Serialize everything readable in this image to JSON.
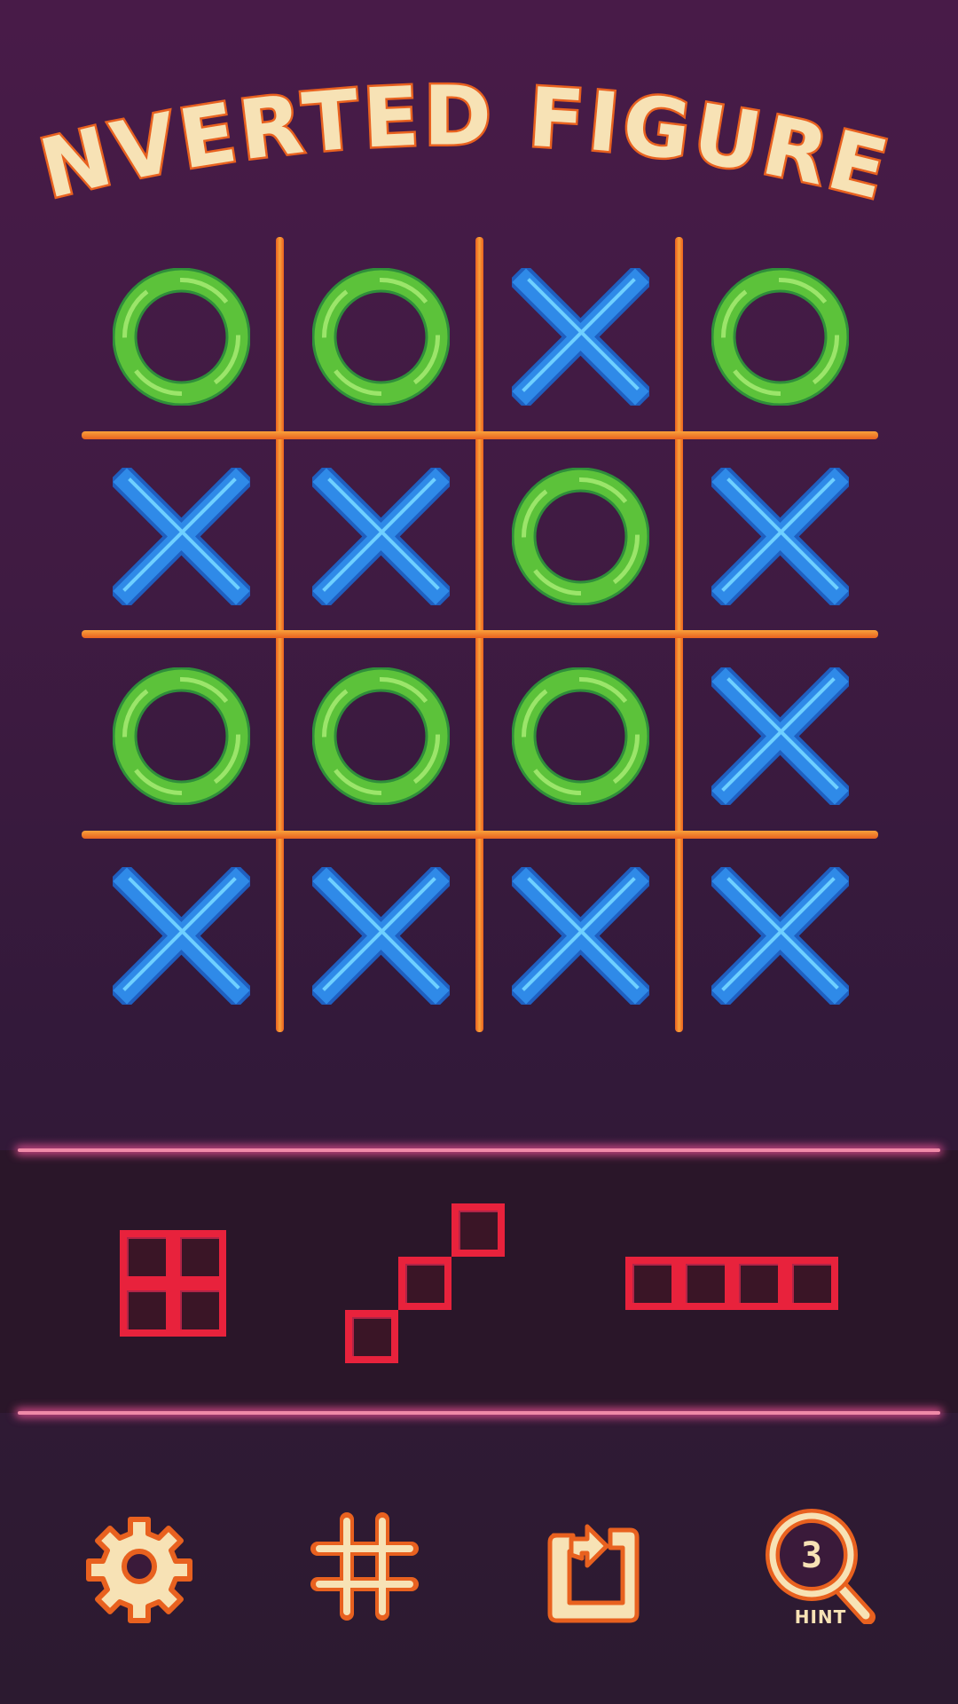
{
  "title": "INVERTED FIGURES",
  "colors": {
    "o_piece": "#5cc23a",
    "x_piece": "#2f8ae8",
    "grid": "#f48a2a",
    "tray_piece": "#e8223c",
    "icon_fill": "#f7e2b5",
    "icon_outline": "#e8611f"
  },
  "board": {
    "rows": [
      [
        "O",
        "O",
        "X",
        "O"
      ],
      [
        "X",
        "X",
        "O",
        "X"
      ],
      [
        "O",
        "O",
        "O",
        "X"
      ],
      [
        "X",
        "X",
        "X",
        "X"
      ]
    ]
  },
  "tray": {
    "pieces": [
      {
        "shape": "square-2x2",
        "icon": "o-tetromino"
      },
      {
        "shape": "diagonal-3",
        "icon": "diagonal-piece"
      },
      {
        "shape": "line-4",
        "icon": "i-tetromino"
      }
    ]
  },
  "toolbar": {
    "settings_icon": "gear-icon",
    "grid_icon": "hash-grid-icon",
    "restart_icon": "rotate-icon",
    "hint_icon": "magnifier-icon",
    "hint_count": "3",
    "hint_label": "HINT"
  }
}
